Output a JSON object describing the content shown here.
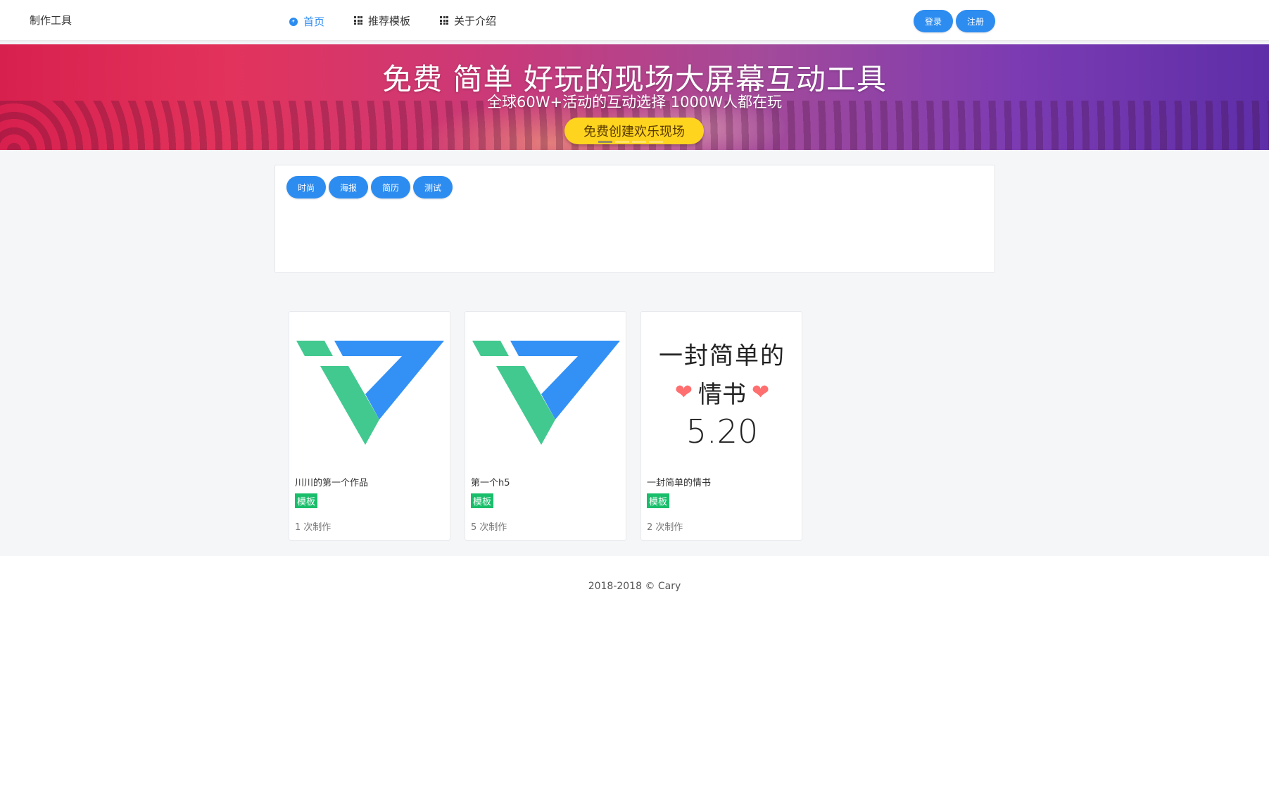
{
  "header": {
    "brand": "制作工具",
    "nav": [
      {
        "label": "首页",
        "icon": "compass-icon",
        "active": true
      },
      {
        "label": "推荐模板",
        "icon": "grid-icon",
        "active": false
      },
      {
        "label": "关于介绍",
        "icon": "grid-icon",
        "active": false
      }
    ],
    "login_label": "登录",
    "register_label": "注册"
  },
  "banner": {
    "title": "免费  简单  好玩的现场大屏幕互动工具",
    "subtitle": "全球60W+活动的互动选择  1000W人都在玩",
    "cta": "免费创建欢乐现场"
  },
  "tags": [
    "时尚",
    "海报",
    "简历",
    "测试"
  ],
  "cards": [
    {
      "title": "川川的第一个作品",
      "badge": "模板",
      "count": "1",
      "count_suffix": "次制作",
      "thumb": "logo-v"
    },
    {
      "title": "第一个h5",
      "badge": "模板",
      "count": "5",
      "count_suffix": "次制作",
      "thumb": "logo-v"
    },
    {
      "title": "一封简单的情书",
      "badge": "模板",
      "count": "2",
      "count_suffix": "次制作",
      "thumb": "love-letter",
      "thumb_text": {
        "line1": "一封简单的",
        "line2": "情书",
        "line3": "5.20"
      }
    }
  ],
  "footer": {
    "text": "2018-2018 © Cary"
  },
  "colors": {
    "primary": "#2d8cf0",
    "badge": "#19be6b",
    "cta": "#ffd41f",
    "logo_green": "#42c98f",
    "logo_blue": "#3391f5"
  }
}
